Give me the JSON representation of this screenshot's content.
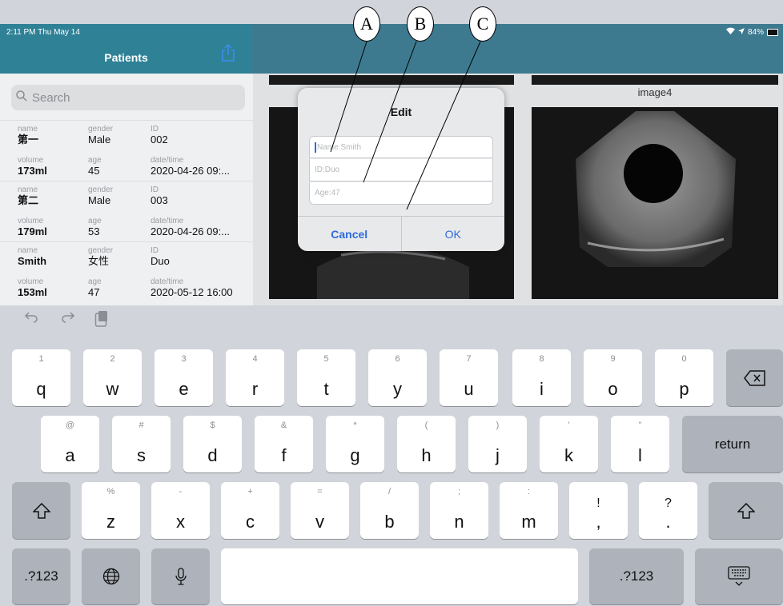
{
  "status": {
    "time_date": "2:11 PM  Thu May 14",
    "battery": "84%"
  },
  "sidebar": {
    "title": "Patients",
    "search_placeholder": "Search",
    "patients": [
      {
        "name_label": "name",
        "name": "第一",
        "gender_label": "gender",
        "gender": "Male",
        "id_label": "ID",
        "id": "002",
        "volume_label": "volume",
        "volume": "173ml",
        "age_label": "age",
        "age": "45",
        "date_label": "date/time",
        "date": "2020-04-26 09:..."
      },
      {
        "name_label": "name",
        "name": "第二",
        "gender_label": "gender",
        "gender": "Male",
        "id_label": "ID",
        "id": "003",
        "volume_label": "volume",
        "volume": "179ml",
        "age_label": "age",
        "age": "53",
        "date_label": "date/time",
        "date": "2020-04-26 09:..."
      },
      {
        "name_label": "name",
        "name": "Smith",
        "gender_label": "gender",
        "gender": "女性",
        "id_label": "ID",
        "id": "Duo",
        "volume_label": "volume",
        "volume": "153ml",
        "age_label": "age",
        "age": "47",
        "date_label": "date/time",
        "date": "2020-05-12 16:00"
      }
    ]
  },
  "content": {
    "image4_label": "image4"
  },
  "dialog": {
    "title": "Edit",
    "name_placeholder": "Name:Smith",
    "id_placeholder": "ID:Duo",
    "age_placeholder": "Age:47",
    "cancel": "Cancel",
    "ok": "OK"
  },
  "callouts": {
    "a": "A",
    "b": "B",
    "c": "C"
  },
  "keyboard": {
    "row1": [
      {
        "hint": "1",
        "key": "q"
      },
      {
        "hint": "2",
        "key": "w"
      },
      {
        "hint": "3",
        "key": "e"
      },
      {
        "hint": "4",
        "key": "r"
      },
      {
        "hint": "5",
        "key": "t"
      },
      {
        "hint": "6",
        "key": "y"
      },
      {
        "hint": "7",
        "key": "u"
      },
      {
        "hint": "8",
        "key": "i"
      },
      {
        "hint": "9",
        "key": "o"
      },
      {
        "hint": "0",
        "key": "p"
      }
    ],
    "row2": [
      {
        "hint": "@",
        "key": "a"
      },
      {
        "hint": "#",
        "key": "s"
      },
      {
        "hint": "$",
        "key": "d"
      },
      {
        "hint": "&",
        "key": "f"
      },
      {
        "hint": "*",
        "key": "g"
      },
      {
        "hint": "(",
        "key": "h"
      },
      {
        "hint": ")",
        "key": "j"
      },
      {
        "hint": "’",
        "key": "k"
      },
      {
        "hint": "”",
        "key": "l"
      }
    ],
    "row3": [
      {
        "hint": "%",
        "key": "z"
      },
      {
        "hint": "-",
        "key": "x"
      },
      {
        "hint": "+",
        "key": "c"
      },
      {
        "hint": "=",
        "key": "v"
      },
      {
        "hint": "/",
        "key": "b"
      },
      {
        "hint": ";",
        "key": "n"
      },
      {
        "hint": ":",
        "key": "m"
      },
      {
        "hint": "!",
        "key": ","
      },
      {
        "hint": "?",
        "key": "."
      }
    ],
    "return_label": "return",
    "numbers_label": ".?123"
  }
}
